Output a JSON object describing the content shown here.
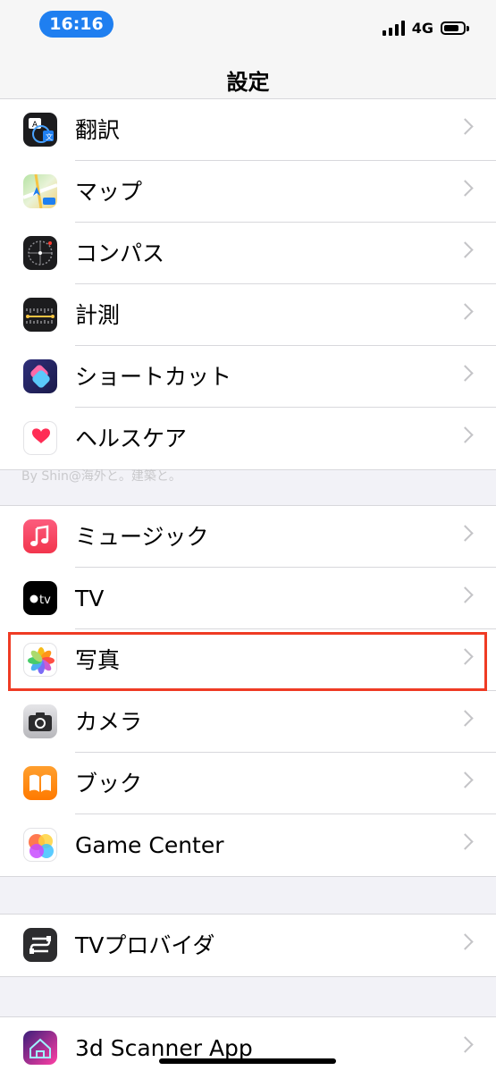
{
  "status_bar": {
    "time": "16:16",
    "network": "4G"
  },
  "nav": {
    "title": "設定"
  },
  "group1": [
    {
      "label": "翻訳",
      "icon": "translate-icon"
    },
    {
      "label": "マップ",
      "icon": "maps-icon"
    },
    {
      "label": "コンパス",
      "icon": "compass-icon"
    },
    {
      "label": "計測",
      "icon": "measure-icon"
    },
    {
      "label": "ショートカット",
      "icon": "shortcuts-icon"
    },
    {
      "label": "ヘルスケア",
      "icon": "health-icon"
    }
  ],
  "watermark": "By Shin@海外と。建築と。",
  "group2": [
    {
      "label": "ミュージック",
      "icon": "music-icon"
    },
    {
      "label": "TV",
      "icon": "tv-icon"
    },
    {
      "label": "写真",
      "icon": "photos-icon"
    },
    {
      "label": "カメラ",
      "icon": "camera-icon"
    },
    {
      "label": "ブック",
      "icon": "books-icon"
    },
    {
      "label": "Game Center",
      "icon": "game-center-icon"
    }
  ],
  "group3": [
    {
      "label": "TVプロバイダ",
      "icon": "tv-provider-icon"
    }
  ],
  "group4": [
    {
      "label": "3d Scanner App",
      "icon": "scanner-app-icon"
    }
  ],
  "colors": {
    "time_pill": "#1f7ff0",
    "highlight": "#ef3b24",
    "chevron": "#c4c4c7"
  }
}
